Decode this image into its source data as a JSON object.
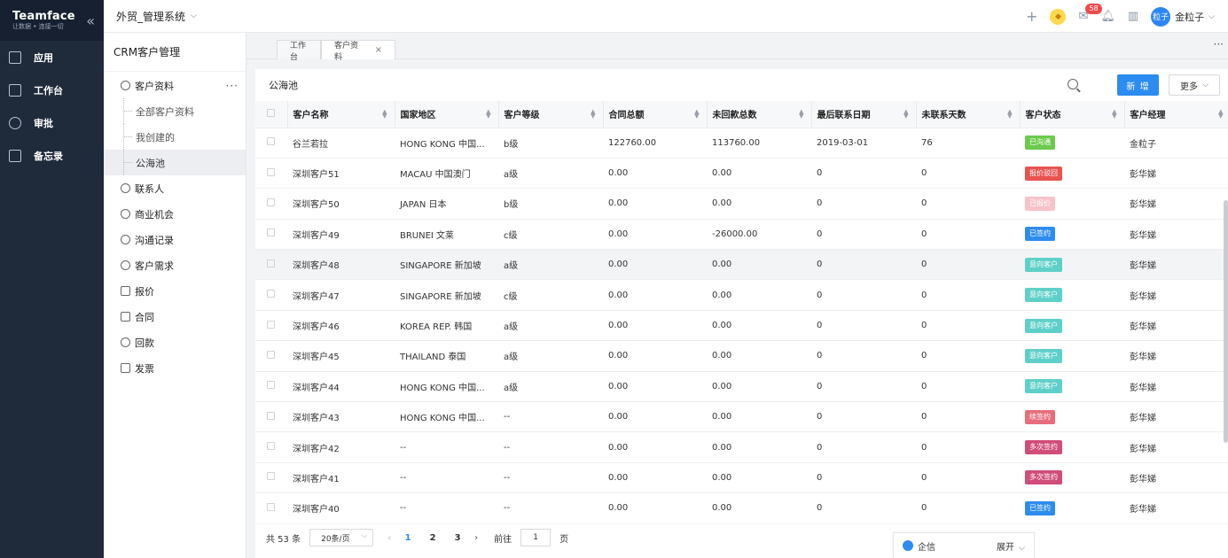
{
  "brand": {
    "name": "Teamface",
    "slogan": "让数据 • 连接一切"
  },
  "leftnav": [
    {
      "label": "应用",
      "icon": "grid-icon"
    },
    {
      "label": "工作台",
      "icon": "monitor-icon"
    },
    {
      "label": "审批",
      "icon": "user-icon"
    },
    {
      "label": "备忘录",
      "icon": "memo-icon"
    }
  ],
  "topbar": {
    "system_name": "外贸_管理系统",
    "mail_badge": "58",
    "username": "金粒子",
    "avatar_text": "粒子"
  },
  "sidebar": {
    "title": "CRM客户管理",
    "customer_label": "客户资料",
    "customer_sub": [
      "全部客户资料",
      "我创建的",
      "公海池"
    ],
    "items": [
      "联系人",
      "商业机会",
      "沟通记录",
      "客户需求",
      "报价",
      "合同",
      "回款",
      "发票"
    ]
  },
  "tabs": [
    {
      "label": "工作台"
    },
    {
      "label": "客户资料"
    }
  ],
  "panel": {
    "title": "公海池",
    "new_label": "新 增",
    "more_label": "更多"
  },
  "table": {
    "headers": [
      "客户名称",
      "国家地区",
      "客户等级",
      "合同总额",
      "未回款总数",
      "最后联系日期",
      "未联系天数",
      "客户状态",
      "客户经理"
    ],
    "rows": [
      {
        "name": "谷兰若拉",
        "region": "HONG KONG 中国...",
        "level": "b级",
        "total": "122760.00",
        "unpaid": "113760.00",
        "last": "2019-03-01",
        "days": "76",
        "status": "已沟通",
        "status_color": "#6ccb4c",
        "manager": "金粒子"
      },
      {
        "name": "深圳客户51",
        "region": "MACAU 中国澳门",
        "level": "a级",
        "total": "0.00",
        "unpaid": "0.00",
        "last": "0",
        "days": "0",
        "status": "报价驳回",
        "status_color": "#e9534f",
        "manager": "彭华娣"
      },
      {
        "name": "深圳客户50",
        "region": "JAPAN 日本",
        "level": "b级",
        "total": "0.00",
        "unpaid": "0.00",
        "last": "0",
        "days": "0",
        "status": "已报价",
        "status_color": "#f7c3c8",
        "manager": "彭华娣"
      },
      {
        "name": "深圳客户49",
        "region": "BRUNEI 文莱",
        "level": "c级",
        "total": "0.00",
        "unpaid": "-26000.00",
        "last": "0",
        "days": "0",
        "status": "已签约",
        "status_color": "#2d8cf0",
        "manager": "彭华娣"
      },
      {
        "name": "深圳客户48",
        "region": "SINGAPORE 新加坡",
        "level": "a级",
        "total": "0.00",
        "unpaid": "0.00",
        "last": "0",
        "days": "0",
        "status": "意向客户",
        "status_color": "#5fd0c9",
        "manager": "彭华娣"
      },
      {
        "name": "深圳客户47",
        "region": "SINGAPORE 新加坡",
        "level": "c级",
        "total": "0.00",
        "unpaid": "0.00",
        "last": "0",
        "days": "0",
        "status": "意向客户",
        "status_color": "#5fd0c9",
        "manager": "彭华娣"
      },
      {
        "name": "深圳客户46",
        "region": "KOREA REP. 韩国",
        "level": "a级",
        "total": "0.00",
        "unpaid": "0.00",
        "last": "0",
        "days": "0",
        "status": "意向客户",
        "status_color": "#5fd0c9",
        "manager": "彭华娣"
      },
      {
        "name": "深圳客户45",
        "region": "THAILAND 泰国",
        "level": "a级",
        "total": "0.00",
        "unpaid": "0.00",
        "last": "0",
        "days": "0",
        "status": "意向客户",
        "status_color": "#5fd0c9",
        "manager": "彭华娣"
      },
      {
        "name": "深圳客户44",
        "region": "HONG KONG 中国...",
        "level": "a级",
        "total": "0.00",
        "unpaid": "0.00",
        "last": "0",
        "days": "0",
        "status": "意向客户",
        "status_color": "#5fd0c9",
        "manager": "彭华娣"
      },
      {
        "name": "深圳客户43",
        "region": "HONG KONG 中国...",
        "level": "--",
        "total": "0.00",
        "unpaid": "0.00",
        "last": "0",
        "days": "0",
        "status": "续签约",
        "status_color": "#e86d7a",
        "manager": "彭华娣"
      },
      {
        "name": "深圳客户42",
        "region": "--",
        "level": "--",
        "total": "0.00",
        "unpaid": "0.00",
        "last": "0",
        "days": "0",
        "status": "多次签约",
        "status_color": "#d14d79",
        "manager": "彭华娣"
      },
      {
        "name": "深圳客户41",
        "region": "--",
        "level": "--",
        "total": "0.00",
        "unpaid": "0.00",
        "last": "0",
        "days": "0",
        "status": "多次签约",
        "status_color": "#d14d79",
        "manager": "彭华娣"
      },
      {
        "name": "深圳客户40",
        "region": "--",
        "level": "--",
        "total": "0.00",
        "unpaid": "0.00",
        "last": "0",
        "days": "0",
        "status": "已签约",
        "status_color": "#2d8cf0",
        "manager": "彭华娣"
      }
    ]
  },
  "pagination": {
    "total": "共 53 条",
    "per_page": "20条/页",
    "pages": [
      "1",
      "2",
      "3"
    ],
    "goto_label": "前往",
    "goto_value": "1",
    "page_unit": "页"
  },
  "qixin": {
    "label": "企信",
    "expand": "展开"
  }
}
